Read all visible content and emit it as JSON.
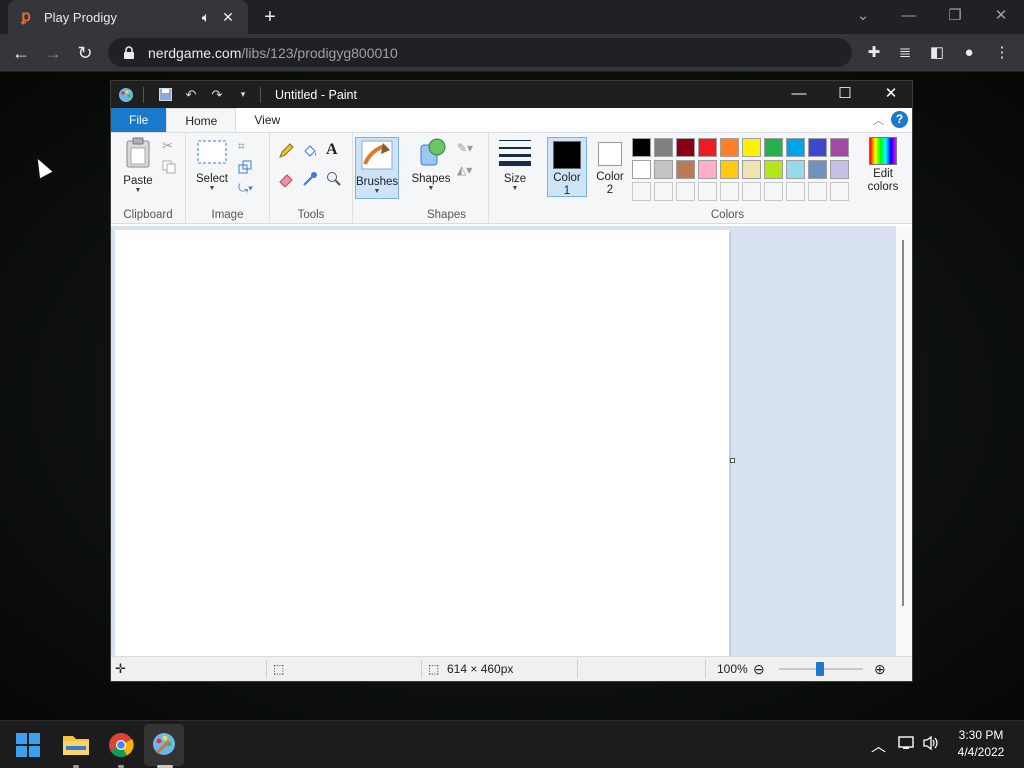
{
  "browser": {
    "tab_title": "Play Prodigy",
    "url_host": "nerdgame.com",
    "url_path": "/libs/123/prodigyg800010",
    "favicon": "prodigy-icon"
  },
  "paint": {
    "title": "Untitled - Paint",
    "tabs": {
      "file": "File",
      "home": "Home",
      "view": "View"
    },
    "help": "?",
    "groups": {
      "clipboard": "Clipboard",
      "image": "Image",
      "tools": "Tools",
      "shapes": "Shapes",
      "colors": "Colors"
    },
    "buttons": {
      "paste": "Paste",
      "select": "Select",
      "brushes": "Brushes",
      "shapes": "Shapes",
      "size": "Size",
      "color1_line1": "Color",
      "color1_line2": "1",
      "color2_line1": "Color",
      "color2_line2": "2",
      "edit_colors_line1": "Edit",
      "edit_colors_line2": "colors"
    },
    "palette_row1": [
      "#000000",
      "#7f7f7f",
      "#880015",
      "#ed1c24",
      "#ff7f27",
      "#fff200",
      "#22b14c",
      "#00a2e8",
      "#3f48cc",
      "#a349a4"
    ],
    "palette_row2": [
      "#ffffff",
      "#c3c3c3",
      "#b97a57",
      "#ffaec9",
      "#ffc90e",
      "#efe4b0",
      "#b5e61d",
      "#99d9ea",
      "#7092be",
      "#c8bfe7"
    ],
    "color1": "#000000",
    "color2": "#ffffff",
    "status": {
      "dimensions": "614 × 460px",
      "zoom": "100%"
    }
  },
  "taskbar": {
    "time": "3:30 PM",
    "date": "4/4/2022"
  }
}
